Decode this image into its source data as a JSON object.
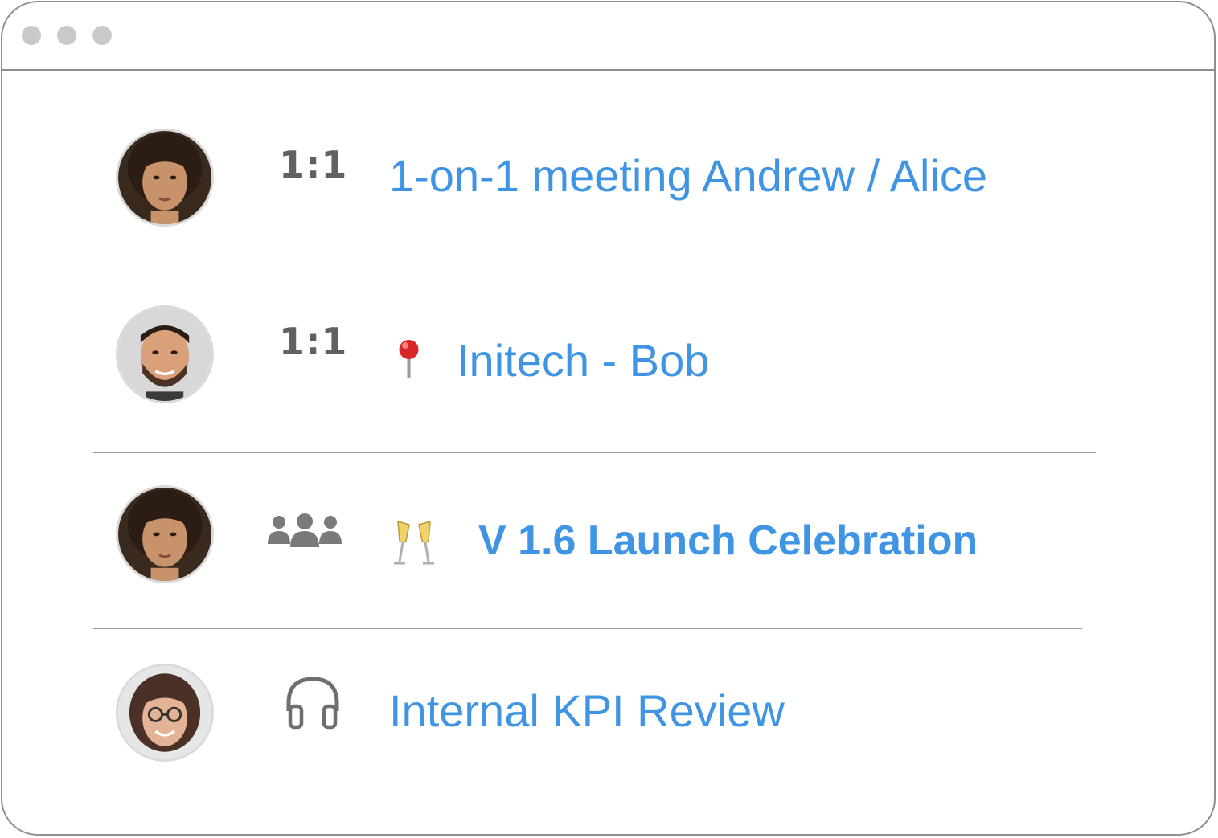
{
  "window": {
    "controls": [
      "close",
      "minimize",
      "maximize"
    ]
  },
  "meetings": [
    {
      "avatar": "woman-curly-hair-avatar",
      "type_label": "1:1",
      "title": "1-on-1 meeting Andrew / Alice"
    },
    {
      "avatar": "man-beard-avatar",
      "type_label": "1:1",
      "emoji": "pin-icon",
      "title": "Initech - Bob"
    },
    {
      "avatar": "woman-curly-hair-avatar",
      "type_icon": "group-icon",
      "emoji": "champagne-glasses-icon",
      "title": "V 1.6 Launch Celebration"
    },
    {
      "avatar": "woman-glasses-avatar",
      "type_icon": "headphones-icon",
      "title": "Internal KPI Review"
    }
  ],
  "colors": {
    "title": "#3f95e4",
    "type_label": "#616161",
    "divider": "#9a9a9a",
    "window_border": "#8f8f8f",
    "window_dot": "#c9c9c9"
  }
}
